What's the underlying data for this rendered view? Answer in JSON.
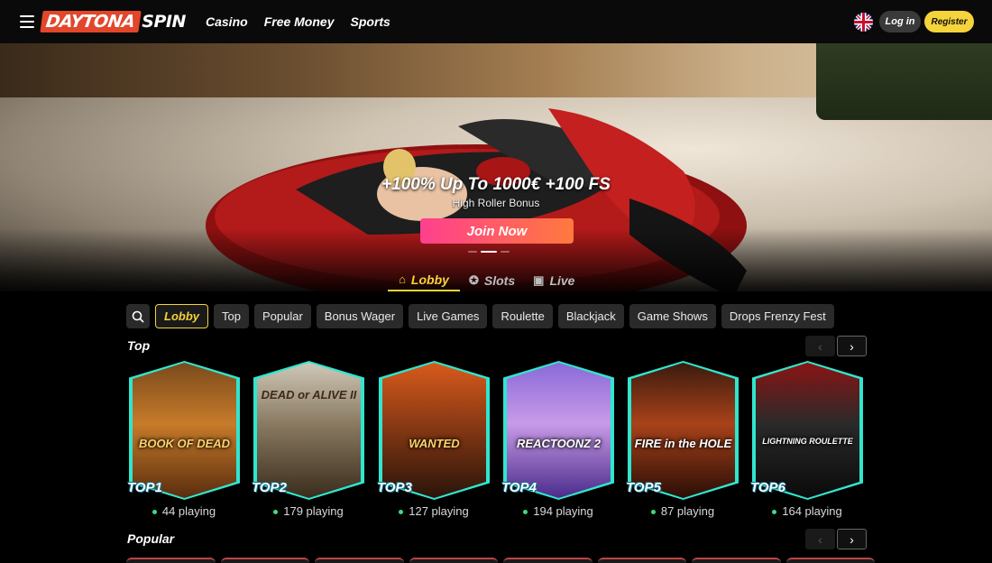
{
  "header": {
    "logo_part1": "DAYTONA",
    "logo_part2": "SPIN",
    "nav": [
      "Casino",
      "Free Money",
      "Sports"
    ],
    "login_label": "Log in",
    "register_label": "Register",
    "language_icon": "uk-flag-icon"
  },
  "hero": {
    "headline": "+100% Up To 1000€ +100 FS",
    "subtitle": "High Roller Bonus",
    "cta_label": "Join Now",
    "tabs": [
      {
        "label": "Lobby",
        "icon": "home-icon",
        "active": true
      },
      {
        "label": "Slots",
        "icon": "slot-chip-icon",
        "active": false
      },
      {
        "label": "Live",
        "icon": "live-cards-icon",
        "active": false
      }
    ]
  },
  "filters": {
    "search_icon": "search-icon",
    "chips": [
      "Lobby",
      "Top",
      "Popular",
      "Bonus Wager",
      "Live Games",
      "Roulette",
      "Blackjack",
      "Game Shows",
      "Drops Frenzy Fest"
    ],
    "active": "Lobby"
  },
  "sections": {
    "top_title": "Top",
    "popular_title": "Popular"
  },
  "top_games": [
    {
      "title": "BOOK OF DEAD",
      "rank": "TOP1",
      "playing": "44 playing"
    },
    {
      "title": "DEAD or ALIVE II",
      "rank": "TOP2",
      "playing": "179 playing"
    },
    {
      "title": "WANTED",
      "rank": "TOP3",
      "playing": "127 playing"
    },
    {
      "title": "REACTOONZ 2",
      "rank": "TOP4",
      "playing": "194 playing"
    },
    {
      "title": "FIRE in the HOLE",
      "rank": "TOP5",
      "playing": "87 playing"
    },
    {
      "title": "LIGHTNING ROULETTE",
      "rank": "TOP6",
      "playing": "164 playing"
    }
  ],
  "colors": {
    "accent": "#f5d33a",
    "cta_start": "#ff3f8e",
    "cta_end": "#ff7a3d",
    "card_glow": "#35ffe6",
    "logo_red": "#e2462b"
  }
}
